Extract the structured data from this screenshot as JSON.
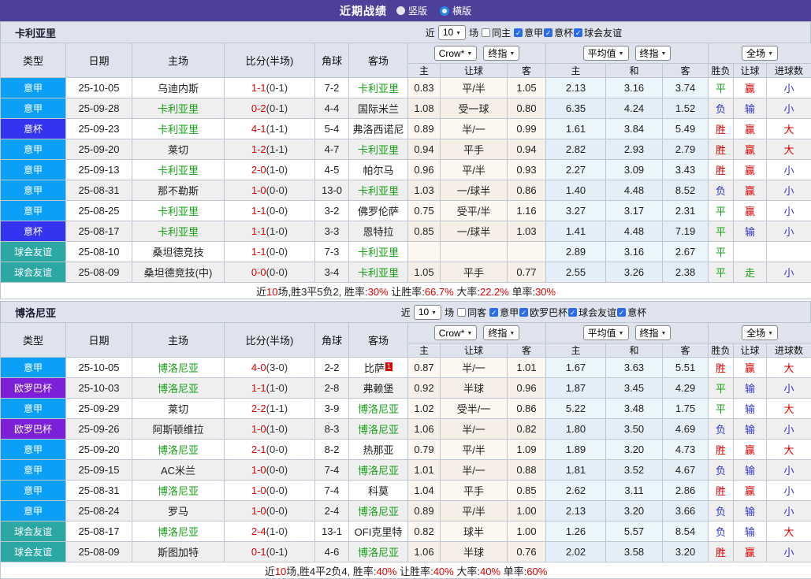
{
  "titlebar": {
    "title": "近期战绩",
    "radios": [
      {
        "label": "竖版",
        "selected": false
      },
      {
        "label": "横版",
        "selected": true
      }
    ]
  },
  "colors": {
    "red": "#e00000",
    "green": "#18a018",
    "blue": "#3333cc",
    "title_bar": "#4d4099",
    "header_bg": "#dee3ee",
    "league": {
      "意甲": "#0b9ff7",
      "意杯": "#3434f0",
      "球会友谊": "#2ba8a4",
      "欧罗巴杯": "#7b1fd9"
    }
  },
  "table_head": {
    "cols": [
      "类型",
      "日期",
      "主场",
      "比分(半场)",
      "角球",
      "客场"
    ],
    "subs": [
      "主",
      "让球",
      "客",
      "主",
      "和",
      "客",
      "胜负",
      "让球",
      "进球数"
    ],
    "dropdowns": [
      "Crow*",
      "终指",
      "平均值",
      "终指",
      "全场"
    ]
  },
  "tables": [
    {
      "team": "卡利亚里",
      "filter": {
        "pre": "近",
        "count": "10",
        "post": "场",
        "same": "同主",
        "leagues": [
          "意甲",
          "意杯",
          "球会友谊"
        ]
      },
      "rows": [
        {
          "lg": "意甲",
          "dt": "25-10-05",
          "h": "乌迪内斯",
          "hg": 0,
          "sc": "1-1",
          "hf": "(0-1)",
          "cn": "7-2",
          "a": "卡利亚里",
          "ag": 1,
          "ab": "",
          "o": [
            "0.83",
            "平/半",
            "1.05"
          ],
          "v": [
            "2.13",
            "3.16",
            "3.74"
          ],
          "r": [
            [
              "平",
              "g"
            ],
            [
              "赢",
              "r"
            ],
            [
              "小",
              "b"
            ]
          ]
        },
        {
          "lg": "意甲",
          "dt": "25-09-28",
          "h": "卡利亚里",
          "hg": 1,
          "sc": "0-2",
          "hf": "(0-1)",
          "cn": "4-4",
          "a": "国际米兰",
          "ag": 0,
          "ab": "",
          "o": [
            "1.08",
            "受一球",
            "0.80"
          ],
          "v": [
            "6.35",
            "4.24",
            "1.52"
          ],
          "r": [
            [
              "负",
              "b"
            ],
            [
              "输",
              "b"
            ],
            [
              "小",
              "b"
            ]
          ]
        },
        {
          "lg": "意杯",
          "dt": "25-09-23",
          "h": "卡利亚里",
          "hg": 1,
          "sc": "4-1",
          "hf": "(1-1)",
          "cn": "5-4",
          "a": "弗洛西诺尼",
          "ag": 0,
          "ab": "",
          "o": [
            "0.89",
            "半/一",
            "0.99"
          ],
          "v": [
            "1.61",
            "3.84",
            "5.49"
          ],
          "r": [
            [
              "胜",
              "r"
            ],
            [
              "赢",
              "r"
            ],
            [
              "大",
              "r"
            ]
          ]
        },
        {
          "lg": "意甲",
          "dt": "25-09-20",
          "h": "莱切",
          "hg": 0,
          "sc": "1-2",
          "hf": "(1-1)",
          "cn": "4-7",
          "a": "卡利亚里",
          "ag": 1,
          "ab": "",
          "o": [
            "0.94",
            "平手",
            "0.94"
          ],
          "v": [
            "2.82",
            "2.93",
            "2.79"
          ],
          "r": [
            [
              "胜",
              "r"
            ],
            [
              "赢",
              "r"
            ],
            [
              "大",
              "r"
            ]
          ]
        },
        {
          "lg": "意甲",
          "dt": "25-09-13",
          "h": "卡利亚里",
          "hg": 1,
          "sc": "2-0",
          "hf": "(1-0)",
          "cn": "4-5",
          "a": "帕尔马",
          "ag": 0,
          "ab": "",
          "o": [
            "0.96",
            "平/半",
            "0.93"
          ],
          "v": [
            "2.27",
            "3.09",
            "3.43"
          ],
          "r": [
            [
              "胜",
              "r"
            ],
            [
              "赢",
              "r"
            ],
            [
              "小",
              "b"
            ]
          ]
        },
        {
          "lg": "意甲",
          "dt": "25-08-31",
          "h": "那不勒斯",
          "hg": 0,
          "sc": "1-0",
          "hf": "(0-0)",
          "cn": "13-0",
          "a": "卡利亚里",
          "ag": 1,
          "ab": "",
          "o": [
            "1.03",
            "一/球半",
            "0.86"
          ],
          "v": [
            "1.40",
            "4.48",
            "8.52"
          ],
          "r": [
            [
              "负",
              "b"
            ],
            [
              "赢",
              "r"
            ],
            [
              "小",
              "b"
            ]
          ]
        },
        {
          "lg": "意甲",
          "dt": "25-08-25",
          "h": "卡利亚里",
          "hg": 1,
          "sc": "1-1",
          "hf": "(0-0)",
          "cn": "3-2",
          "a": "佛罗伦萨",
          "ag": 0,
          "ab": "",
          "o": [
            "0.75",
            "受平/半",
            "1.16"
          ],
          "v": [
            "3.27",
            "3.17",
            "2.31"
          ],
          "r": [
            [
              "平",
              "g"
            ],
            [
              "赢",
              "r"
            ],
            [
              "小",
              "b"
            ]
          ]
        },
        {
          "lg": "意杯",
          "dt": "25-08-17",
          "h": "卡利亚里",
          "hg": 1,
          "sc": "1-1",
          "hf": "(1-0)",
          "cn": "3-3",
          "a": "恩特拉",
          "ag": 0,
          "ab": "",
          "o": [
            "0.85",
            "一/球半",
            "1.03"
          ],
          "v": [
            "1.41",
            "4.48",
            "7.19"
          ],
          "r": [
            [
              "平",
              "g"
            ],
            [
              "输",
              "b"
            ],
            [
              "小",
              "b"
            ]
          ]
        },
        {
          "lg": "球会友谊",
          "dt": "25-08-10",
          "h": "桑坦德竞技",
          "hg": 0,
          "sc": "1-1",
          "hf": "(0-0)",
          "cn": "7-3",
          "a": "卡利亚里",
          "ag": 1,
          "ab": "",
          "o": [
            "",
            "",
            ""
          ],
          "v": [
            "2.89",
            "3.16",
            "2.67"
          ],
          "r": [
            [
              "平",
              "g"
            ],
            [
              "",
              ""
            ],
            [
              "",
              ""
            ]
          ]
        },
        {
          "lg": "球会友谊",
          "dt": "25-08-09",
          "h": "桑坦德竞技(中)",
          "hg": 0,
          "sc": "0-0",
          "hf": "(0-0)",
          "cn": "3-4",
          "a": "卡利亚里",
          "ag": 1,
          "ab": "",
          "o": [
            "1.05",
            "平手",
            "0.77"
          ],
          "v": [
            "2.55",
            "3.26",
            "2.38"
          ],
          "r": [
            [
              "平",
              "g"
            ],
            [
              "走",
              "g"
            ],
            [
              "小",
              "b"
            ]
          ]
        }
      ],
      "summary": [
        [
          "近",
          0
        ],
        [
          "10",
          1
        ],
        [
          "场,胜3平5负2, 胜率:",
          0
        ],
        [
          "30%",
          1
        ],
        [
          " 让胜率:",
          0
        ],
        [
          "66.7%",
          1
        ],
        [
          " 大率:",
          0
        ],
        [
          "22.2%",
          1
        ],
        [
          " 单率:",
          0
        ],
        [
          "30%",
          1
        ]
      ]
    },
    {
      "team": "博洛尼亚",
      "filter": {
        "pre": "近",
        "count": "10",
        "post": "场",
        "same": "同客",
        "leagues": [
          "意甲",
          "欧罗巴杯",
          "球会友谊",
          "意杯"
        ]
      },
      "rows": [
        {
          "lg": "意甲",
          "dt": "25-10-05",
          "h": "博洛尼亚",
          "hg": 1,
          "sc": "4-0",
          "hf": "(3-0)",
          "cn": "2-2",
          "a": "比萨",
          "ag": 0,
          "ab": "1",
          "o": [
            "0.87",
            "半/一",
            "1.01"
          ],
          "v": [
            "1.67",
            "3.63",
            "5.51"
          ],
          "r": [
            [
              "胜",
              "r"
            ],
            [
              "赢",
              "r"
            ],
            [
              "大",
              "r"
            ]
          ]
        },
        {
          "lg": "欧罗巴杯",
          "dt": "25-10-03",
          "h": "博洛尼亚",
          "hg": 1,
          "sc": "1-1",
          "hf": "(1-0)",
          "cn": "2-8",
          "a": "弗赖堡",
          "ag": 0,
          "ab": "",
          "o": [
            "0.92",
            "半球",
            "0.96"
          ],
          "v": [
            "1.87",
            "3.45",
            "4.29"
          ],
          "r": [
            [
              "平",
              "g"
            ],
            [
              "输",
              "b"
            ],
            [
              "小",
              "b"
            ]
          ]
        },
        {
          "lg": "意甲",
          "dt": "25-09-29",
          "h": "莱切",
          "hg": 0,
          "sc": "2-2",
          "hf": "(1-1)",
          "cn": "3-9",
          "a": "博洛尼亚",
          "ag": 1,
          "ab": "",
          "o": [
            "1.02",
            "受半/一",
            "0.86"
          ],
          "v": [
            "5.22",
            "3.48",
            "1.75"
          ],
          "r": [
            [
              "平",
              "g"
            ],
            [
              "输",
              "b"
            ],
            [
              "大",
              "r"
            ]
          ]
        },
        {
          "lg": "欧罗巴杯",
          "dt": "25-09-26",
          "h": "阿斯顿维拉",
          "hg": 0,
          "sc": "1-0",
          "hf": "(1-0)",
          "cn": "8-3",
          "a": "博洛尼亚",
          "ag": 1,
          "ab": "",
          "o": [
            "1.06",
            "半/一",
            "0.82"
          ],
          "v": [
            "1.80",
            "3.50",
            "4.69"
          ],
          "r": [
            [
              "负",
              "b"
            ],
            [
              "输",
              "b"
            ],
            [
              "小",
              "b"
            ]
          ]
        },
        {
          "lg": "意甲",
          "dt": "25-09-20",
          "h": "博洛尼亚",
          "hg": 1,
          "sc": "2-1",
          "hf": "(0-0)",
          "cn": "8-2",
          "a": "热那亚",
          "ag": 0,
          "ab": "",
          "o": [
            "0.79",
            "平/半",
            "1.09"
          ],
          "v": [
            "1.89",
            "3.20",
            "4.73"
          ],
          "r": [
            [
              "胜",
              "r"
            ],
            [
              "赢",
              "r"
            ],
            [
              "大",
              "r"
            ]
          ]
        },
        {
          "lg": "意甲",
          "dt": "25-09-15",
          "h": "AC米兰",
          "hg": 0,
          "sc": "1-0",
          "hf": "(0-0)",
          "cn": "7-4",
          "a": "博洛尼亚",
          "ag": 1,
          "ab": "",
          "o": [
            "1.01",
            "半/一",
            "0.88"
          ],
          "v": [
            "1.81",
            "3.52",
            "4.67"
          ],
          "r": [
            [
              "负",
              "b"
            ],
            [
              "输",
              "b"
            ],
            [
              "小",
              "b"
            ]
          ]
        },
        {
          "lg": "意甲",
          "dt": "25-08-31",
          "h": "博洛尼亚",
          "hg": 1,
          "sc": "1-0",
          "hf": "(0-0)",
          "cn": "7-4",
          "a": "科莫",
          "ag": 0,
          "ab": "",
          "o": [
            "1.04",
            "平手",
            "0.85"
          ],
          "v": [
            "2.62",
            "3.11",
            "2.86"
          ],
          "r": [
            [
              "胜",
              "r"
            ],
            [
              "赢",
              "r"
            ],
            [
              "小",
              "b"
            ]
          ]
        },
        {
          "lg": "意甲",
          "dt": "25-08-24",
          "h": "罗马",
          "hg": 0,
          "sc": "1-0",
          "hf": "(0-0)",
          "cn": "2-4",
          "a": "博洛尼亚",
          "ag": 1,
          "ab": "",
          "o": [
            "0.89",
            "平/半",
            "1.00"
          ],
          "v": [
            "2.13",
            "3.20",
            "3.66"
          ],
          "r": [
            [
              "负",
              "b"
            ],
            [
              "输",
              "b"
            ],
            [
              "小",
              "b"
            ]
          ]
        },
        {
          "lg": "球会友谊",
          "dt": "25-08-17",
          "h": "博洛尼亚",
          "hg": 1,
          "sc": "2-4",
          "hf": "(1-0)",
          "cn": "13-1",
          "a": "OFI克里特",
          "ag": 0,
          "ab": "",
          "o": [
            "0.82",
            "球半",
            "1.00"
          ],
          "v": [
            "1.26",
            "5.57",
            "8.54"
          ],
          "r": [
            [
              "负",
              "b"
            ],
            [
              "输",
              "b"
            ],
            [
              "大",
              "r"
            ]
          ]
        },
        {
          "lg": "球会友谊",
          "dt": "25-08-09",
          "h": "斯图加特",
          "hg": 0,
          "sc": "0-1",
          "hf": "(0-1)",
          "cn": "4-6",
          "a": "博洛尼亚",
          "ag": 1,
          "ab": "",
          "o": [
            "1.06",
            "半球",
            "0.76"
          ],
          "v": [
            "2.02",
            "3.58",
            "3.20"
          ],
          "r": [
            [
              "胜",
              "r"
            ],
            [
              "赢",
              "r"
            ],
            [
              "小",
              "b"
            ]
          ]
        }
      ],
      "summary": [
        [
          "近",
          0
        ],
        [
          "10",
          1
        ],
        [
          "场,胜4平2负4, 胜率:",
          0
        ],
        [
          "40%",
          1
        ],
        [
          " 让胜率:",
          0
        ],
        [
          "40%",
          1
        ],
        [
          " 大率:",
          0
        ],
        [
          "40%",
          1
        ],
        [
          " 单率:",
          0
        ],
        [
          "60%",
          1
        ]
      ]
    }
  ]
}
